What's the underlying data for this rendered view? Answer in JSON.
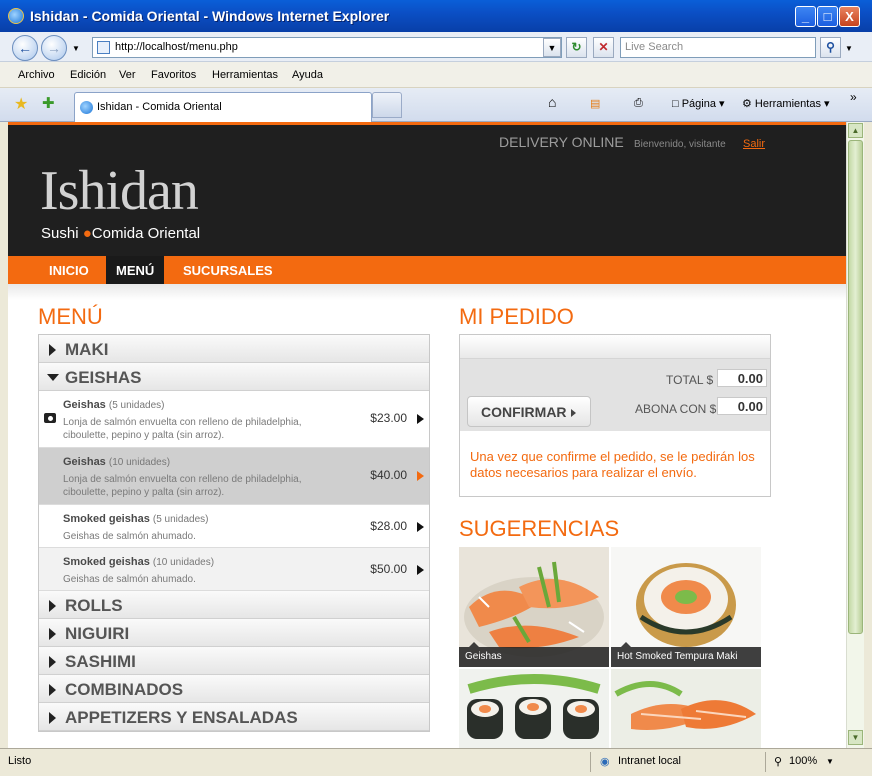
{
  "window": {
    "title": "Ishidan - Comida Oriental - Windows Internet Explorer",
    "min": "_",
    "max": "□",
    "close": "X"
  },
  "address": {
    "url": "http://localhost/menu.php",
    "search_placeholder": "Live Search"
  },
  "menubar": [
    "Archivo",
    "Edición",
    "Ver",
    "Favoritos",
    "Herramientas",
    "Ayuda"
  ],
  "tabs": {
    "active": "Ishidan - Comida Oriental",
    "toolbar": {
      "page": "Página",
      "tools": "Herramientas"
    }
  },
  "site": {
    "delivery": "DELIVERY ONLINE",
    "welcome": "Bienvenido, visitante",
    "logout": "Salir",
    "logo": "Ishidan",
    "tagline_a": "Sushi",
    "tagline_b": "Comida Oriental",
    "nav": [
      "INICIO",
      "MENÚ",
      "SUCURSALES"
    ]
  },
  "menu": {
    "title": "MENÚ",
    "categories": [
      "MAKI",
      "GEISHAS",
      "ROLLS",
      "NIGUIRI",
      "SASHIMI",
      "COMBINADOS",
      "APPETIZERS Y ENSALADAS"
    ],
    "products": [
      {
        "name": "Geishas",
        "qty": "(5 unidades)",
        "desc": "Lonja de salmón envuelta con relleno de philadelphia, ciboulette, pepino y palta (sin arroz).",
        "price": "$23.00"
      },
      {
        "name": "Geishas",
        "qty": "(10 unidades)",
        "desc": "Lonja de salmón envuelta con relleno de philadelphia, ciboulette, pepino y palta (sin arroz).",
        "price": "$40.00"
      },
      {
        "name": "Smoked geishas",
        "qty": "(5 unidades)",
        "desc": "Geishas de salmón ahumado.",
        "price": "$28.00"
      },
      {
        "name": "Smoked geishas",
        "qty": "(10 unidades)",
        "desc": "Geishas de salmón ahumado.",
        "price": "$50.00"
      }
    ]
  },
  "order": {
    "title": "MI PEDIDO",
    "total_label": "TOTAL $",
    "total_value": "0.00",
    "pay_label": "ABONA CON $",
    "pay_value": "0.00",
    "confirm": "CONFIRMAR",
    "note": "Una vez que confirme el pedido, se le pedirán los datos necesarios para realizar el envío."
  },
  "suggestions": {
    "title": "SUGERENCIAS",
    "items": [
      "Geishas",
      "Hot Smoked Tempura Maki"
    ]
  },
  "status": {
    "text": "Listo",
    "zone": "Intranet local",
    "zoom": "100%"
  },
  "colors": {
    "accent": "#f36a10",
    "header_bg": "#1f1f1f"
  }
}
